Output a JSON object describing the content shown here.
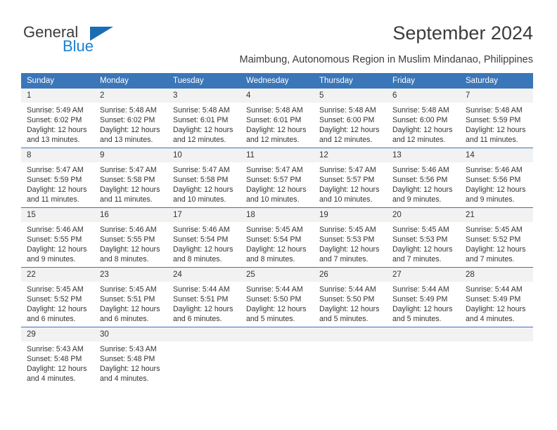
{
  "brand": {
    "name_part1": "General",
    "name_part2": "Blue",
    "triangle_color": "#1a6cb5",
    "blue_color": "#1a7fd4"
  },
  "header": {
    "title": "September 2024",
    "subtitle": "Maimbung, Autonomous Region in Muslim Mindanao, Philippines"
  },
  "calendar": {
    "header_bg": "#3a76b8",
    "daynum_bg": "#f2f2f2",
    "weekdays": [
      "Sunday",
      "Monday",
      "Tuesday",
      "Wednesday",
      "Thursday",
      "Friday",
      "Saturday"
    ],
    "weeks": [
      [
        {
          "day": "1",
          "sunrise": "Sunrise: 5:49 AM",
          "sunset": "Sunset: 6:02 PM",
          "daylight1": "Daylight: 12 hours",
          "daylight2": "and 13 minutes."
        },
        {
          "day": "2",
          "sunrise": "Sunrise: 5:48 AM",
          "sunset": "Sunset: 6:02 PM",
          "daylight1": "Daylight: 12 hours",
          "daylight2": "and 13 minutes."
        },
        {
          "day": "3",
          "sunrise": "Sunrise: 5:48 AM",
          "sunset": "Sunset: 6:01 PM",
          "daylight1": "Daylight: 12 hours",
          "daylight2": "and 12 minutes."
        },
        {
          "day": "4",
          "sunrise": "Sunrise: 5:48 AM",
          "sunset": "Sunset: 6:01 PM",
          "daylight1": "Daylight: 12 hours",
          "daylight2": "and 12 minutes."
        },
        {
          "day": "5",
          "sunrise": "Sunrise: 5:48 AM",
          "sunset": "Sunset: 6:00 PM",
          "daylight1": "Daylight: 12 hours",
          "daylight2": "and 12 minutes."
        },
        {
          "day": "6",
          "sunrise": "Sunrise: 5:48 AM",
          "sunset": "Sunset: 6:00 PM",
          "daylight1": "Daylight: 12 hours",
          "daylight2": "and 12 minutes."
        },
        {
          "day": "7",
          "sunrise": "Sunrise: 5:48 AM",
          "sunset": "Sunset: 5:59 PM",
          "daylight1": "Daylight: 12 hours",
          "daylight2": "and 11 minutes."
        }
      ],
      [
        {
          "day": "8",
          "sunrise": "Sunrise: 5:47 AM",
          "sunset": "Sunset: 5:59 PM",
          "daylight1": "Daylight: 12 hours",
          "daylight2": "and 11 minutes."
        },
        {
          "day": "9",
          "sunrise": "Sunrise: 5:47 AM",
          "sunset": "Sunset: 5:58 PM",
          "daylight1": "Daylight: 12 hours",
          "daylight2": "and 11 minutes."
        },
        {
          "day": "10",
          "sunrise": "Sunrise: 5:47 AM",
          "sunset": "Sunset: 5:58 PM",
          "daylight1": "Daylight: 12 hours",
          "daylight2": "and 10 minutes."
        },
        {
          "day": "11",
          "sunrise": "Sunrise: 5:47 AM",
          "sunset": "Sunset: 5:57 PM",
          "daylight1": "Daylight: 12 hours",
          "daylight2": "and 10 minutes."
        },
        {
          "day": "12",
          "sunrise": "Sunrise: 5:47 AM",
          "sunset": "Sunset: 5:57 PM",
          "daylight1": "Daylight: 12 hours",
          "daylight2": "and 10 minutes."
        },
        {
          "day": "13",
          "sunrise": "Sunrise: 5:46 AM",
          "sunset": "Sunset: 5:56 PM",
          "daylight1": "Daylight: 12 hours",
          "daylight2": "and 9 minutes."
        },
        {
          "day": "14",
          "sunrise": "Sunrise: 5:46 AM",
          "sunset": "Sunset: 5:56 PM",
          "daylight1": "Daylight: 12 hours",
          "daylight2": "and 9 minutes."
        }
      ],
      [
        {
          "day": "15",
          "sunrise": "Sunrise: 5:46 AM",
          "sunset": "Sunset: 5:55 PM",
          "daylight1": "Daylight: 12 hours",
          "daylight2": "and 9 minutes."
        },
        {
          "day": "16",
          "sunrise": "Sunrise: 5:46 AM",
          "sunset": "Sunset: 5:55 PM",
          "daylight1": "Daylight: 12 hours",
          "daylight2": "and 8 minutes."
        },
        {
          "day": "17",
          "sunrise": "Sunrise: 5:46 AM",
          "sunset": "Sunset: 5:54 PM",
          "daylight1": "Daylight: 12 hours",
          "daylight2": "and 8 minutes."
        },
        {
          "day": "18",
          "sunrise": "Sunrise: 5:45 AM",
          "sunset": "Sunset: 5:54 PM",
          "daylight1": "Daylight: 12 hours",
          "daylight2": "and 8 minutes."
        },
        {
          "day": "19",
          "sunrise": "Sunrise: 5:45 AM",
          "sunset": "Sunset: 5:53 PM",
          "daylight1": "Daylight: 12 hours",
          "daylight2": "and 7 minutes."
        },
        {
          "day": "20",
          "sunrise": "Sunrise: 5:45 AM",
          "sunset": "Sunset: 5:53 PM",
          "daylight1": "Daylight: 12 hours",
          "daylight2": "and 7 minutes."
        },
        {
          "day": "21",
          "sunrise": "Sunrise: 5:45 AM",
          "sunset": "Sunset: 5:52 PM",
          "daylight1": "Daylight: 12 hours",
          "daylight2": "and 7 minutes."
        }
      ],
      [
        {
          "day": "22",
          "sunrise": "Sunrise: 5:45 AM",
          "sunset": "Sunset: 5:52 PM",
          "daylight1": "Daylight: 12 hours",
          "daylight2": "and 6 minutes."
        },
        {
          "day": "23",
          "sunrise": "Sunrise: 5:45 AM",
          "sunset": "Sunset: 5:51 PM",
          "daylight1": "Daylight: 12 hours",
          "daylight2": "and 6 minutes."
        },
        {
          "day": "24",
          "sunrise": "Sunrise: 5:44 AM",
          "sunset": "Sunset: 5:51 PM",
          "daylight1": "Daylight: 12 hours",
          "daylight2": "and 6 minutes."
        },
        {
          "day": "25",
          "sunrise": "Sunrise: 5:44 AM",
          "sunset": "Sunset: 5:50 PM",
          "daylight1": "Daylight: 12 hours",
          "daylight2": "and 5 minutes."
        },
        {
          "day": "26",
          "sunrise": "Sunrise: 5:44 AM",
          "sunset": "Sunset: 5:50 PM",
          "daylight1": "Daylight: 12 hours",
          "daylight2": "and 5 minutes."
        },
        {
          "day": "27",
          "sunrise": "Sunrise: 5:44 AM",
          "sunset": "Sunset: 5:49 PM",
          "daylight1": "Daylight: 12 hours",
          "daylight2": "and 5 minutes."
        },
        {
          "day": "28",
          "sunrise": "Sunrise: 5:44 AM",
          "sunset": "Sunset: 5:49 PM",
          "daylight1": "Daylight: 12 hours",
          "daylight2": "and 4 minutes."
        }
      ],
      [
        {
          "day": "29",
          "sunrise": "Sunrise: 5:43 AM",
          "sunset": "Sunset: 5:48 PM",
          "daylight1": "Daylight: 12 hours",
          "daylight2": "and 4 minutes."
        },
        {
          "day": "30",
          "sunrise": "Sunrise: 5:43 AM",
          "sunset": "Sunset: 5:48 PM",
          "daylight1": "Daylight: 12 hours",
          "daylight2": "and 4 minutes."
        },
        {
          "day": "",
          "sunrise": "",
          "sunset": "",
          "daylight1": "",
          "daylight2": ""
        },
        {
          "day": "",
          "sunrise": "",
          "sunset": "",
          "daylight1": "",
          "daylight2": ""
        },
        {
          "day": "",
          "sunrise": "",
          "sunset": "",
          "daylight1": "",
          "daylight2": ""
        },
        {
          "day": "",
          "sunrise": "",
          "sunset": "",
          "daylight1": "",
          "daylight2": ""
        },
        {
          "day": "",
          "sunrise": "",
          "sunset": "",
          "daylight1": "",
          "daylight2": ""
        }
      ]
    ]
  }
}
